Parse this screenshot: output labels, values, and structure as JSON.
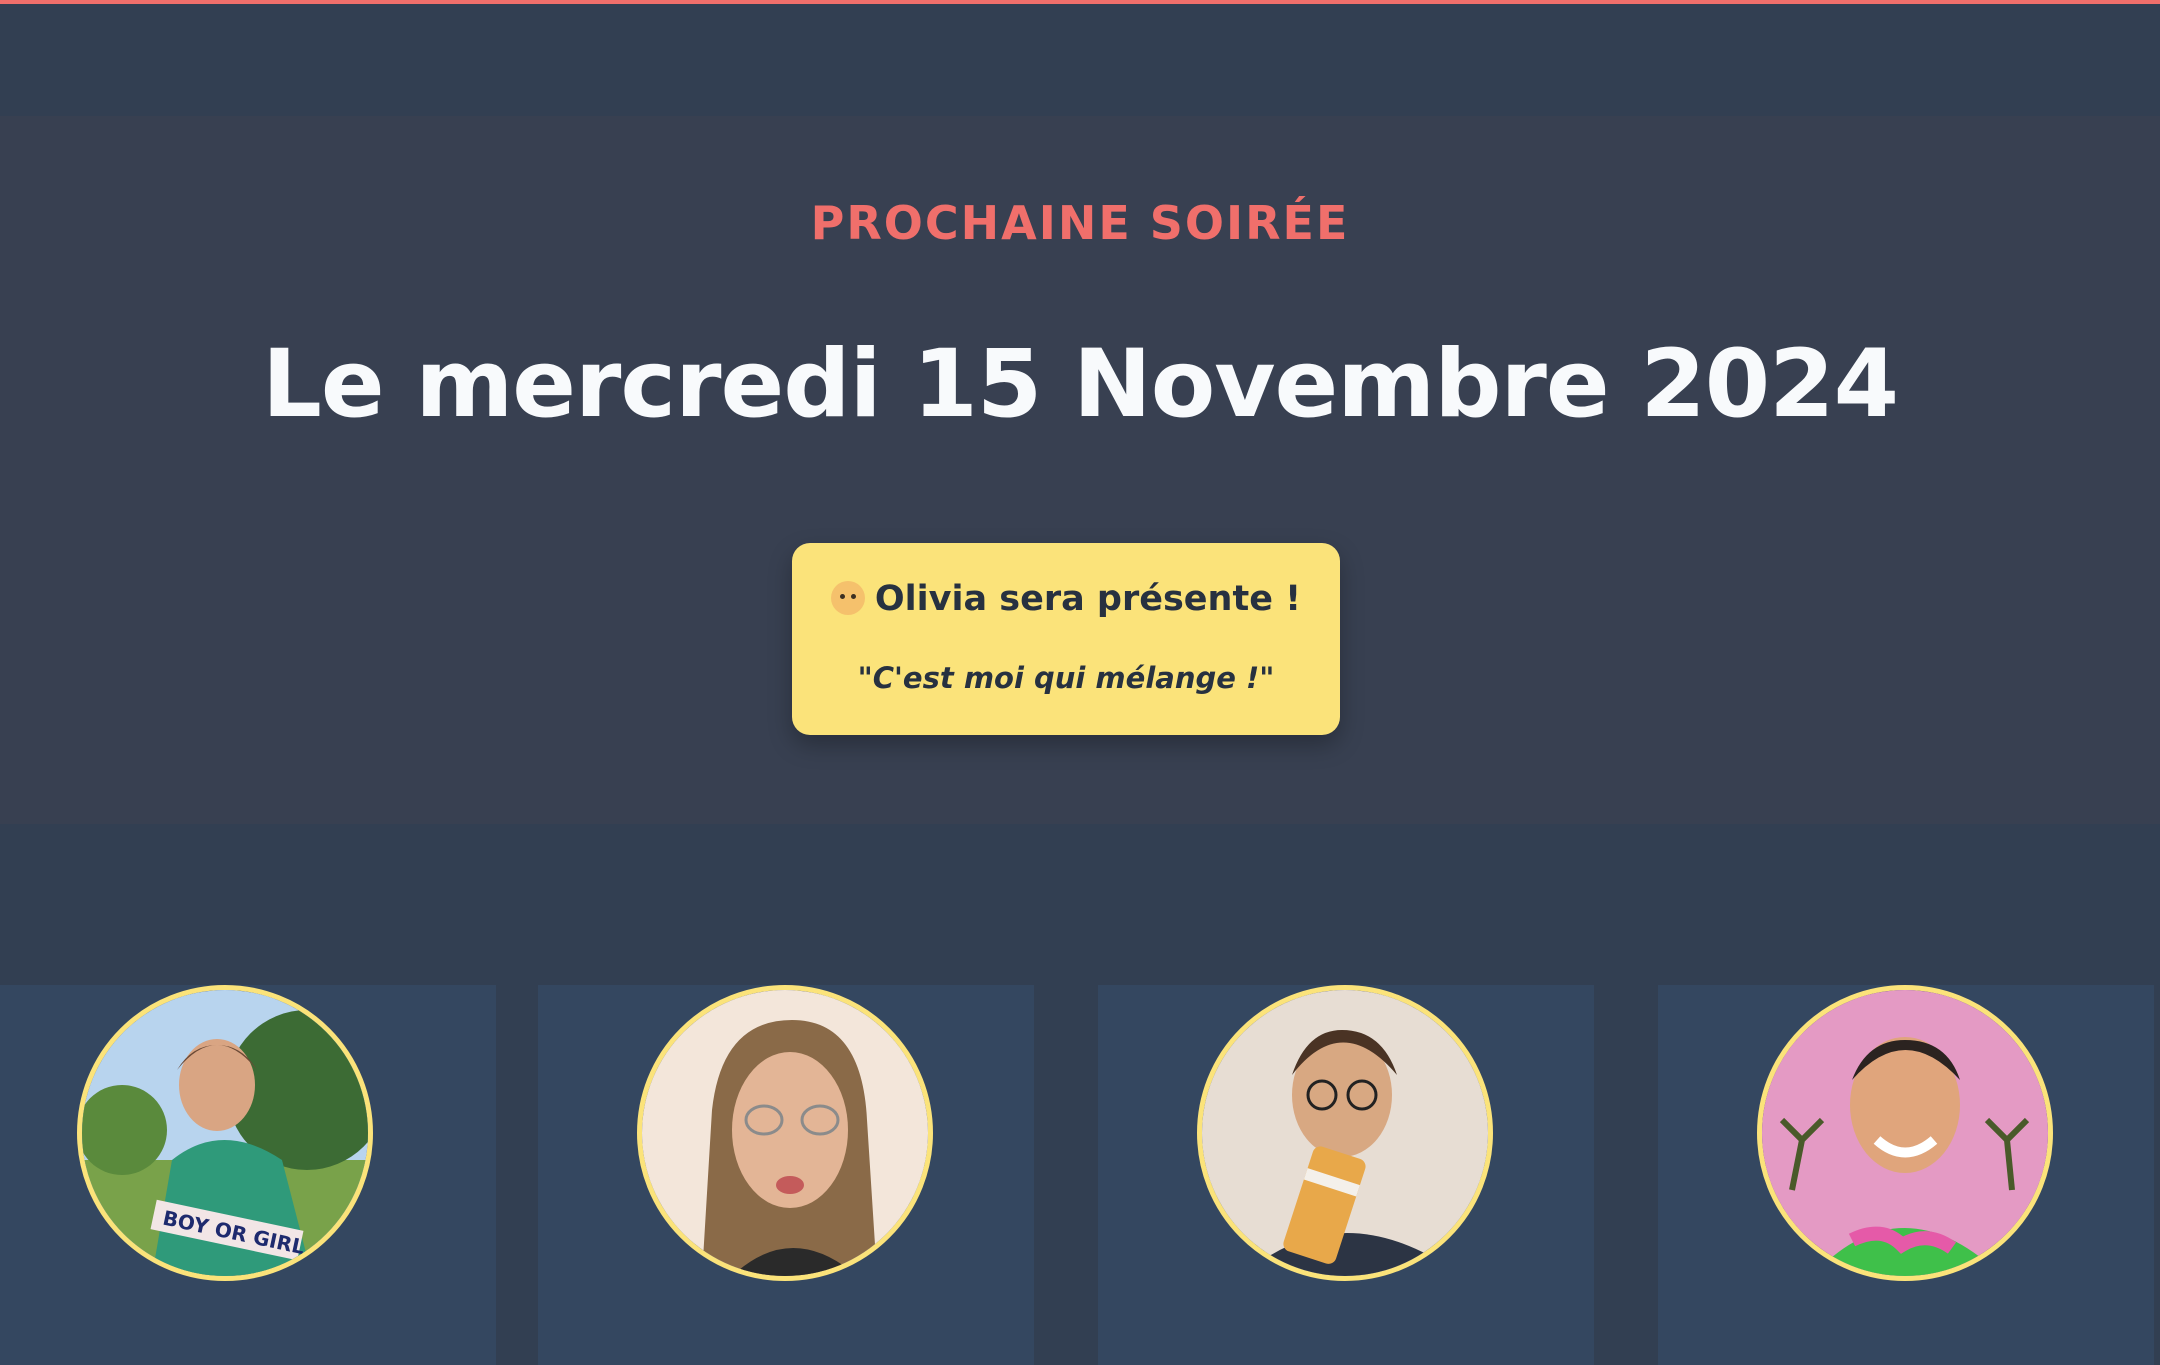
{
  "next_event": {
    "kicker": "PROCHAINE SOIRÉE",
    "date": "Le mercredi 15 Novembre 2024"
  },
  "guest": {
    "icon": "baby-face-icon",
    "line": "Olivia sera présente !",
    "quote": "\"C'est moi qui mélange !\""
  },
  "members": [
    {
      "avatar_sign": "BOY OR GIRL"
    },
    {},
    {},
    {}
  ],
  "colors": {
    "accent": "#f06f6b",
    "highlight": "#fbe37a",
    "page_bg": "#323f52",
    "hero_bg": "#384051",
    "card_bg": "#344760",
    "title_text": "#f8fafc"
  }
}
